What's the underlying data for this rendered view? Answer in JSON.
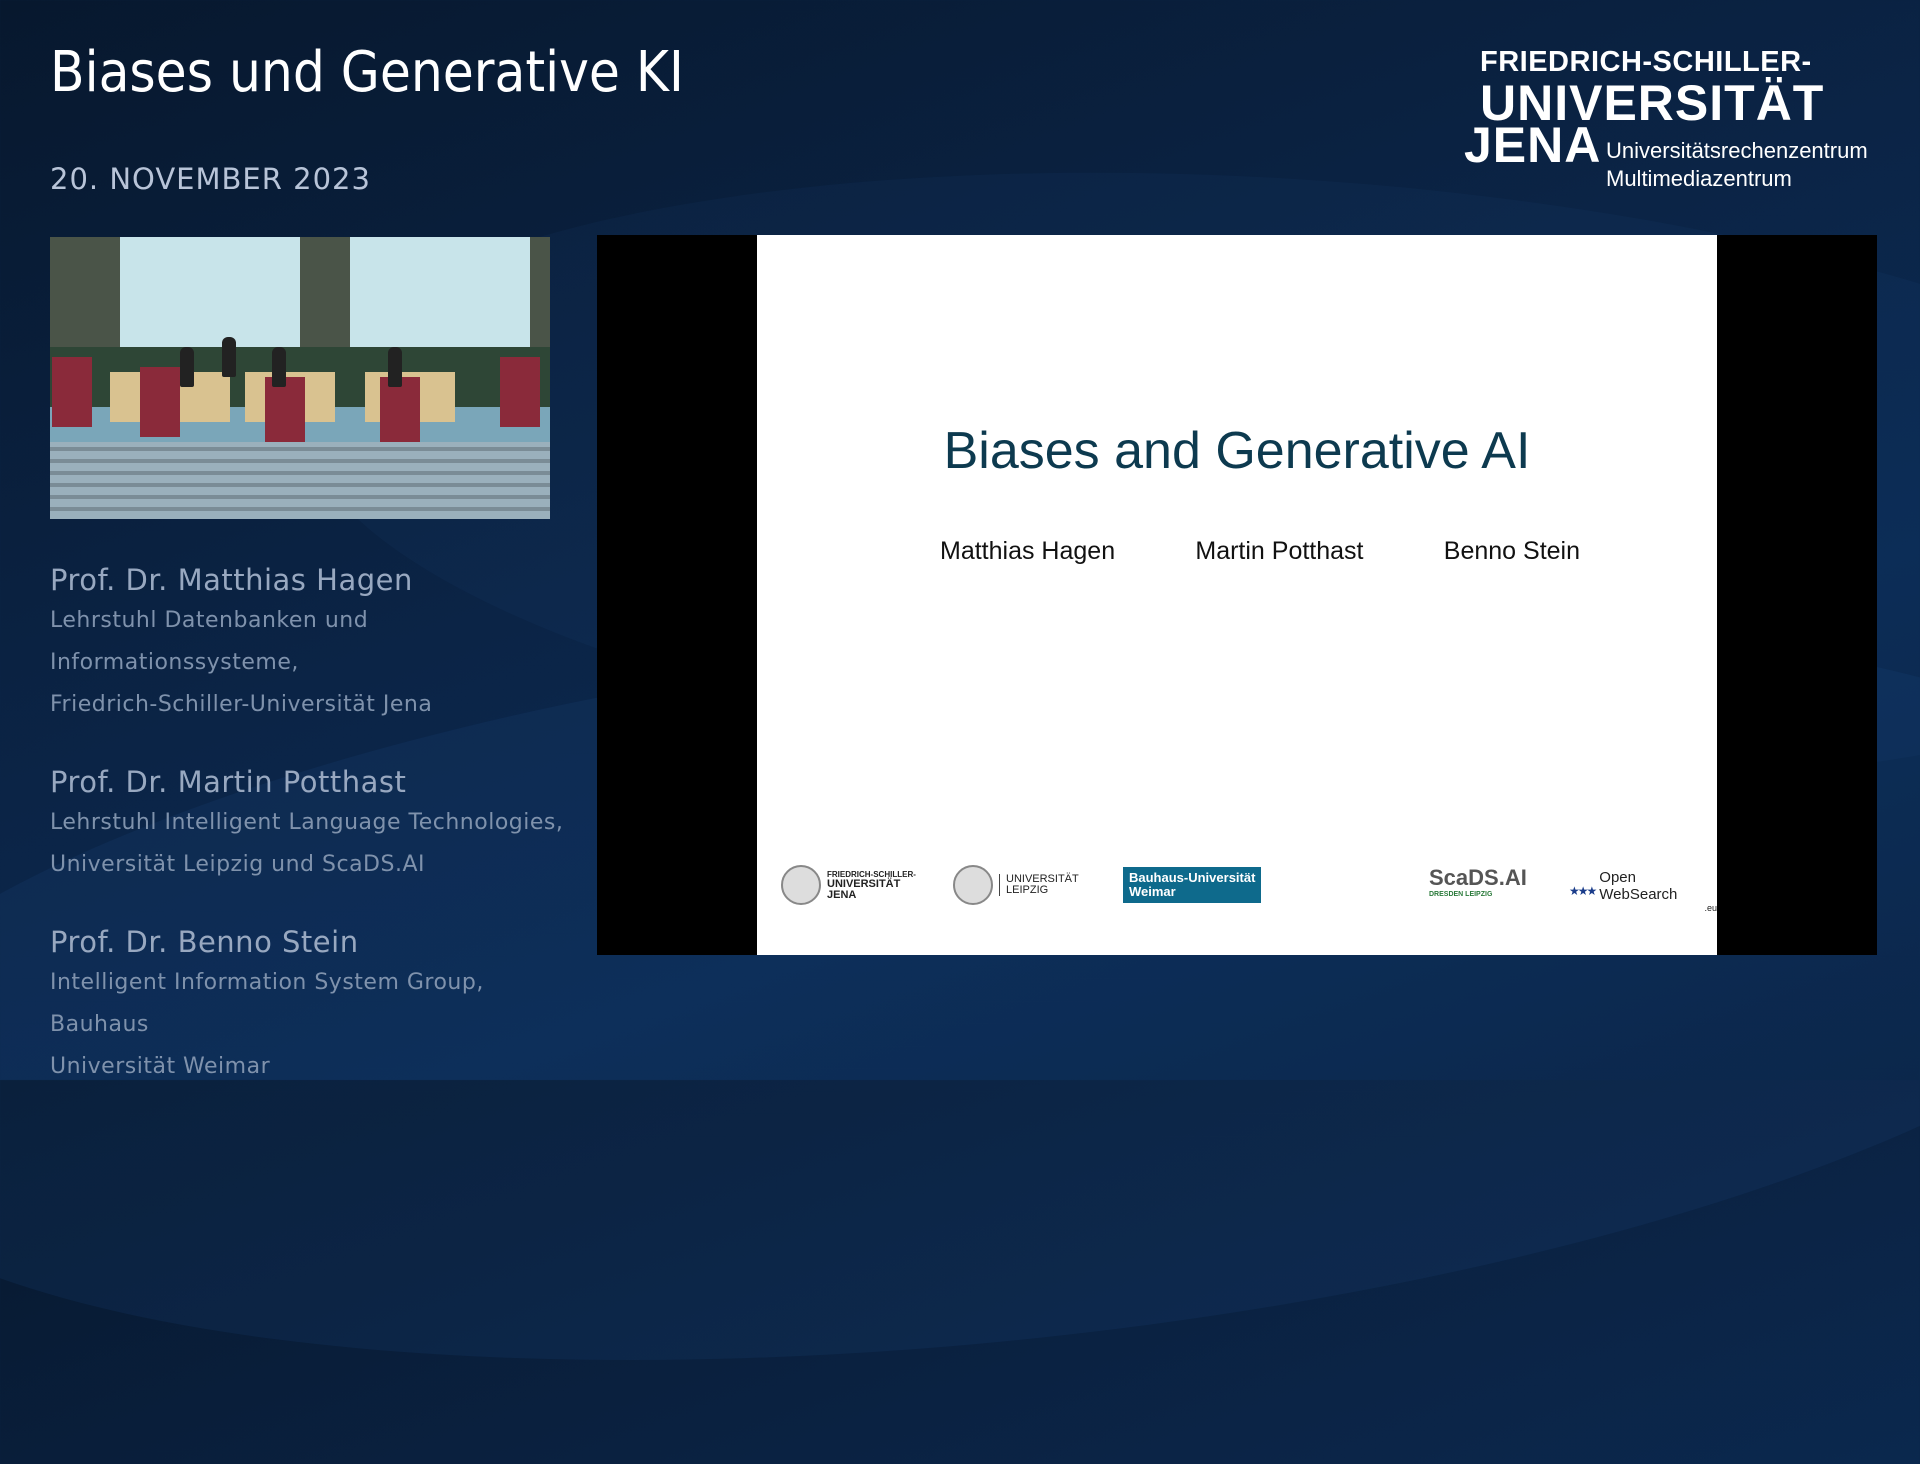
{
  "event": {
    "title": "Biases und Generative KI",
    "date": "20. NOVEMBER 2023"
  },
  "logo": {
    "line1": "FRIEDRICH-SCHILLER-",
    "line2": "UNIVERSITÄT",
    "line3": "JENA",
    "line4": "Universitätsrechenzentrum",
    "line5": "Multimediazentrum"
  },
  "speakers": [
    {
      "name": "Prof. Dr. Matthias Hagen",
      "aff_line1": "Lehrstuhl Datenbanken und Informationssysteme,",
      "aff_line2": "Friedrich-Schiller-Universität Jena"
    },
    {
      "name": "Prof. Dr. Martin Potthast",
      "aff_line1": "Lehrstuhl Intelligent Language Technologies,",
      "aff_line2": "Universität Leipzig und ScaDS.AI"
    },
    {
      "name": "Prof. Dr. Benno Stein",
      "aff_line1": "Intelligent Information System Group, Bauhaus",
      "aff_line2": "Universität Weimar"
    }
  ],
  "slide": {
    "title": "Biases and Generative AI",
    "authors": [
      "Matthias Hagen",
      "Martin Potthast",
      "Benno Stein"
    ],
    "footer_logos": {
      "jena_line1": "FRIEDRICH-SCHILLER-",
      "jena_line2": "UNIVERSITÄT",
      "jena_line3": "JENA",
      "leipzig_line1": "UNIVERSITÄT",
      "leipzig_line2": "LEIPZIG",
      "bauhaus_line1": "Bauhaus-Universität",
      "bauhaus_line2": "Weimar",
      "scads": "ScaDS.AI",
      "scads_sub": "DRESDEN LEIPZIG",
      "ows": "Open WebSearch",
      "ows_sub": ".eu"
    }
  },
  "colors": {
    "background": "#0b2446",
    "slide_title": "#0d3a4f",
    "bauhaus": "#0e6a8c"
  }
}
